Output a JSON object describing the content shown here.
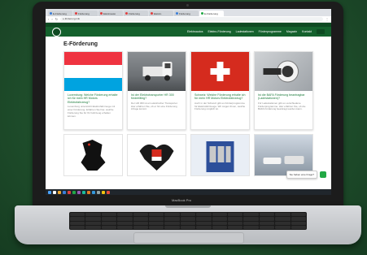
{
  "browser": {
    "tabs": [
      {
        "label": "E-Förderung",
        "color": "#3b7ed8",
        "active": false
      },
      {
        "label": "Förderung",
        "color": "#e04040",
        "active": false
      },
      {
        "label": "Elektroauto",
        "color": "#e04040",
        "active": false
      },
      {
        "label": "Förderung",
        "color": "#e04040",
        "active": false
      },
      {
        "label": "Elektro",
        "color": "#e04040",
        "active": false
      },
      {
        "label": "Förderung",
        "color": "#3b7ed8",
        "active": false
      },
      {
        "label": "E-Förderung",
        "color": "#22a845",
        "active": true
      }
    ],
    "url": "e-förderung.info"
  },
  "site": {
    "menu": [
      "Elektroautos",
      "Elektro-Förderung",
      "Ladestationen",
      "Förderprogramme",
      "Magazin",
      "Kontakt"
    ],
    "heading": "E-Förderung"
  },
  "cards": [
    {
      "title": "Luxemburg: Welche Förderung erhalte ich für mein HR Motors Elektrofahrzeug?",
      "text": "Luxemburg unterstützt Elektrofahrzeuge mit einer Förderung. Erfahren Sie hier, welche Förderung Sie für Ihr Fahrzeug erhalten können."
    },
    {
      "title": "Ist der Elektrotransporter HR 300 förderfähig?",
      "text": "Der HR 300 ist ein elektrischer Transporter. Hier erfahren Sie, ob er für eine Förderung infrage kommt."
    },
    {
      "title": "Schweiz: Welche Förderung erhalte ich für mein HR Motors Elektrofahrzeug?",
      "text": "Auch in der Schweiz gibt es Förderprogramme für Elektrofahrzeuge. Wir zeigen Ihnen, welche Förderung möglich ist."
    },
    {
      "title": "Ist die BAFA Förderung beantragbar (Ladestationen)?",
      "text": "Für Ladestationen gibt es verschiedene Förderprogramme. Hier erfahren Sie, ob die BAFA Förderung beantragt werden kann."
    }
  ],
  "chat": {
    "label": "Sie haben eine Frage?"
  },
  "laptop": {
    "model": "MacBook Pro"
  },
  "colors": {
    "site_green": "#14612d",
    "link_green": "#1a7a3a",
    "background": "#1f4f2c"
  }
}
